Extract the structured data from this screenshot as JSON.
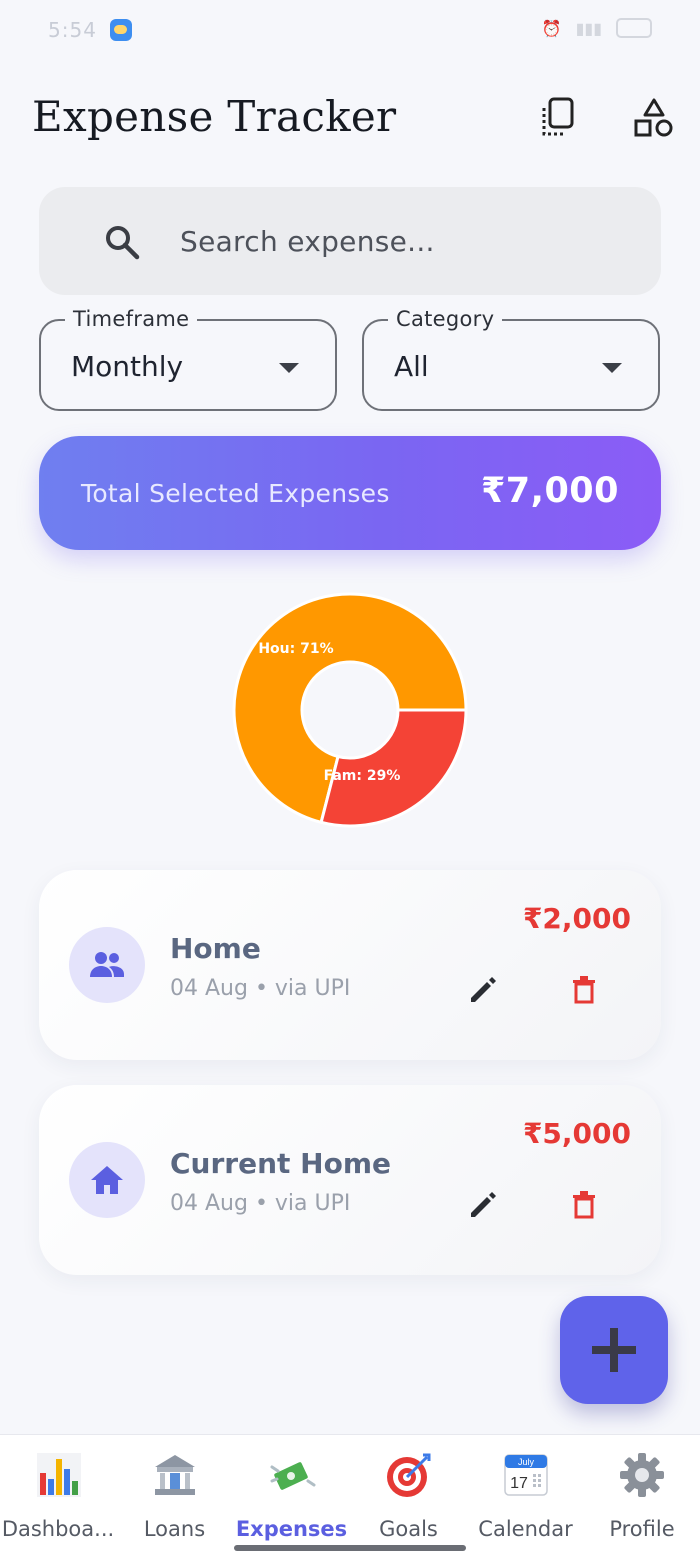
{
  "status_bar": {
    "time": "5:54"
  },
  "header": {
    "title": "Expense Tracker"
  },
  "search": {
    "placeholder": "Search expense..."
  },
  "filters": {
    "timeframe": {
      "label": "Timeframe",
      "value": "Monthly"
    },
    "category": {
      "label": "Category",
      "value": "All"
    }
  },
  "total": {
    "label": "Total Selected Expenses",
    "value": "₹7,000"
  },
  "chart_data": {
    "type": "pie",
    "categories": [
      "Hou",
      "Fam"
    ],
    "values": [
      71,
      29
    ],
    "labels": [
      "Hou: 71%",
      "Fam: 29%"
    ],
    "colors": [
      "#ff9800",
      "#f44336"
    ],
    "donut": true
  },
  "expenses": [
    {
      "title": "Home",
      "subtitle": "04 Aug • via UPI",
      "amount": "₹2,000",
      "icon": "people-icon"
    },
    {
      "title": "Current Home",
      "subtitle": "04 Aug • via UPI",
      "amount": "₹5,000",
      "icon": "house-icon"
    }
  ],
  "nav": {
    "items": [
      {
        "label": "Dashboa...",
        "icon": "bar-chart-icon"
      },
      {
        "label": "Loans",
        "icon": "bank-icon"
      },
      {
        "label": "Expenses",
        "icon": "money-icon",
        "active": true
      },
      {
        "label": "Goals",
        "icon": "target-icon"
      },
      {
        "label": "Calendar",
        "icon": "calendar-icon"
      },
      {
        "label": "Profile",
        "icon": "gear-icon"
      }
    ],
    "calendar_month": "July",
    "calendar_day": "17"
  },
  "colors": {
    "accent": "#5f63ea",
    "gradient_start": "#6f7ff0",
    "gradient_end": "#8b5cf6",
    "expense_amount": "#e53935"
  }
}
